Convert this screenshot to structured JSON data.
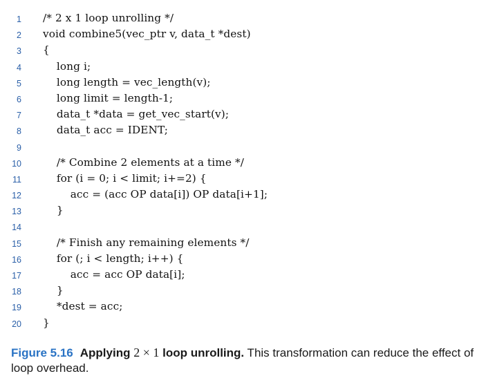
{
  "code": {
    "lines": [
      {
        "num": "1",
        "text": "/* 2 x 1 loop unrolling */"
      },
      {
        "num": "2",
        "text": "void combine5(vec_ptr v, data_t *dest)"
      },
      {
        "num": "3",
        "text": "{"
      },
      {
        "num": "4",
        "text": "    long i;"
      },
      {
        "num": "5",
        "text": "    long length = vec_length(v);"
      },
      {
        "num": "6",
        "text": "    long limit = length-1;"
      },
      {
        "num": "7",
        "text": "    data_t *data = get_vec_start(v);"
      },
      {
        "num": "8",
        "text": "    data_t acc = IDENT;"
      },
      {
        "num": "9",
        "text": ""
      },
      {
        "num": "10",
        "text": "    /* Combine 2 elements at a time */"
      },
      {
        "num": "11",
        "text": "    for (i = 0; i < limit; i+=2) {"
      },
      {
        "num": "12",
        "text": "        acc = (acc OP data[i]) OP data[i+1];"
      },
      {
        "num": "13",
        "text": "    }"
      },
      {
        "num": "14",
        "text": ""
      },
      {
        "num": "15",
        "text": "    /* Finish any remaining elements */"
      },
      {
        "num": "16",
        "text": "    for (; i < length; i++) {"
      },
      {
        "num": "17",
        "text": "        acc = acc OP data[i];"
      },
      {
        "num": "18",
        "text": "    }"
      },
      {
        "num": "19",
        "text": "    *dest = acc;"
      },
      {
        "num": "20",
        "text": "}"
      }
    ]
  },
  "caption": {
    "label": "Figure 5.16",
    "title_part1": "Applying ",
    "title_math": "2 × 1",
    "title_part2": " loop unrolling.",
    "body": " This transformation can reduce the effect of loop overhead."
  },
  "colors": {
    "line_number": "#2a5fa8",
    "figure_label": "#2a73c4",
    "text": "#111111"
  }
}
